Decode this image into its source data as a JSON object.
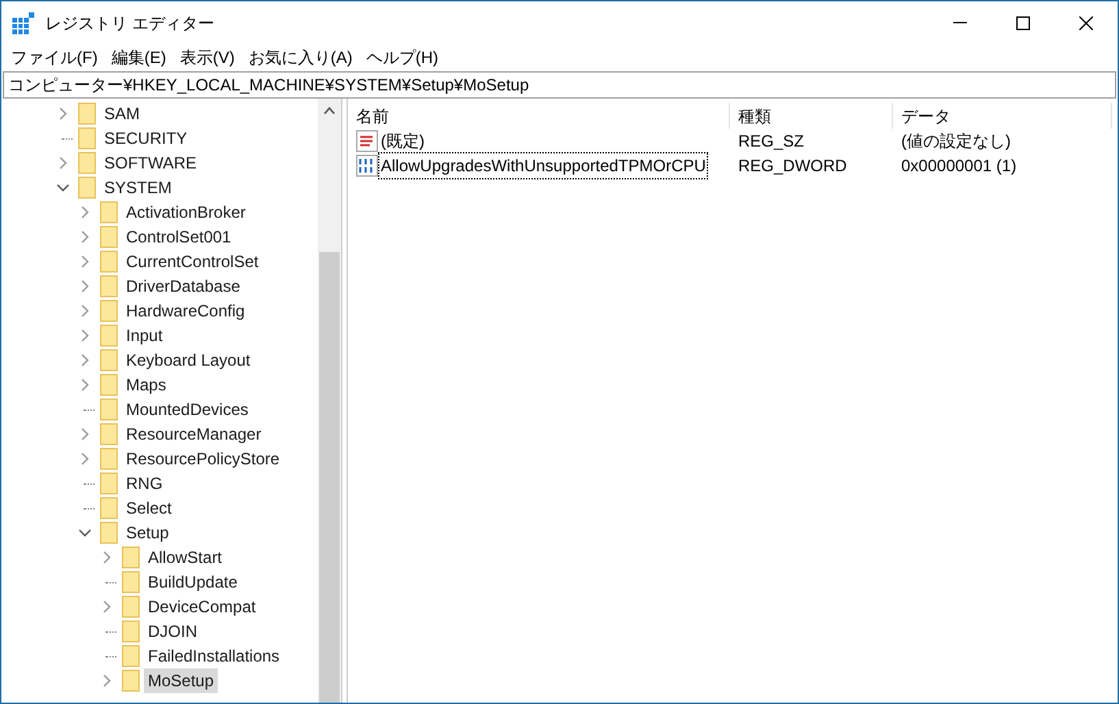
{
  "window": {
    "title": "レジストリ エディター"
  },
  "menu": [
    "ファイル(F)",
    "編集(E)",
    "表示(V)",
    "お気に入り(A)",
    "ヘルプ(H)"
  ],
  "address": "コンピューター¥HKEY_LOCAL_MACHINE¥SYSTEM¥Setup¥MoSetup",
  "tree": [
    {
      "label": "SAM",
      "has_children": true,
      "expanded": false,
      "selected": false
    },
    {
      "label": "SECURITY",
      "has_children": false,
      "expanded": false,
      "selected": false
    },
    {
      "label": "SOFTWARE",
      "has_children": true,
      "expanded": false,
      "selected": false
    },
    {
      "label": "SYSTEM",
      "has_children": true,
      "expanded": true,
      "selected": false,
      "children": [
        {
          "label": "ActivationBroker",
          "has_children": true,
          "expanded": false,
          "selected": false
        },
        {
          "label": "ControlSet001",
          "has_children": true,
          "expanded": false,
          "selected": false
        },
        {
          "label": "CurrentControlSet",
          "has_children": true,
          "expanded": false,
          "selected": false
        },
        {
          "label": "DriverDatabase",
          "has_children": true,
          "expanded": false,
          "selected": false
        },
        {
          "label": "HardwareConfig",
          "has_children": true,
          "expanded": false,
          "selected": false
        },
        {
          "label": "Input",
          "has_children": true,
          "expanded": false,
          "selected": false
        },
        {
          "label": "Keyboard Layout",
          "has_children": true,
          "expanded": false,
          "selected": false
        },
        {
          "label": "Maps",
          "has_children": true,
          "expanded": false,
          "selected": false
        },
        {
          "label": "MountedDevices",
          "has_children": false,
          "expanded": false,
          "selected": false
        },
        {
          "label": "ResourceManager",
          "has_children": true,
          "expanded": false,
          "selected": false
        },
        {
          "label": "ResourcePolicyStore",
          "has_children": true,
          "expanded": false,
          "selected": false
        },
        {
          "label": "RNG",
          "has_children": false,
          "expanded": false,
          "selected": false
        },
        {
          "label": "Select",
          "has_children": false,
          "expanded": false,
          "selected": false
        },
        {
          "label": "Setup",
          "has_children": true,
          "expanded": true,
          "selected": false,
          "children": [
            {
              "label": "AllowStart",
              "has_children": true,
              "expanded": false,
              "selected": false
            },
            {
              "label": "BuildUpdate",
              "has_children": false,
              "expanded": false,
              "selected": false
            },
            {
              "label": "DeviceCompat",
              "has_children": true,
              "expanded": false,
              "selected": false
            },
            {
              "label": "DJOIN",
              "has_children": false,
              "expanded": false,
              "selected": false
            },
            {
              "label": "FailedInstallations",
              "has_children": false,
              "expanded": false,
              "selected": false
            },
            {
              "label": "MoSetup",
              "has_children": true,
              "expanded": false,
              "selected": true
            }
          ]
        }
      ]
    }
  ],
  "values": {
    "columns": [
      "名前",
      "種類",
      "データ"
    ],
    "rows": [
      {
        "kind": "string",
        "name": "(既定)",
        "type": "REG_SZ",
        "data": "(値の設定なし)",
        "selected": false
      },
      {
        "kind": "binary",
        "name": "AllowUpgradesWithUnsupportedTPMOrCPU",
        "type": "REG_DWORD",
        "data": "0x00000001 (1)",
        "selected": true
      }
    ]
  }
}
